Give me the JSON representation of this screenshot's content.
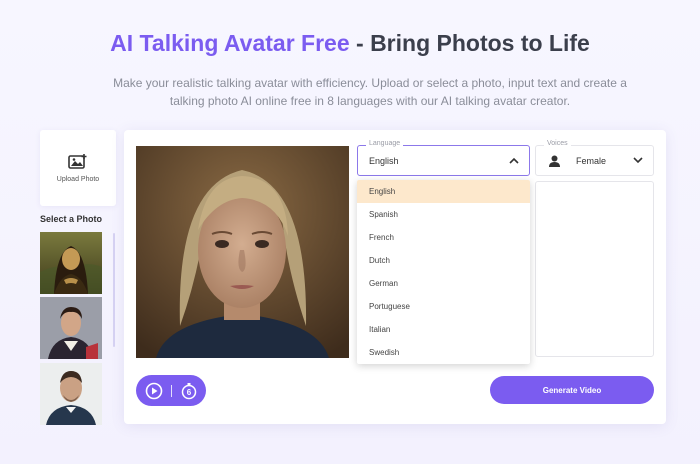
{
  "header": {
    "title_accent": "AI Talking Avatar Free",
    "title_rest": " - Bring Photos to Life",
    "subtitle": "Make your realistic talking avatar with efficiency. Upload or select a photo, input text and create a talking photo AI online free in 8 languages with our AI talking avatar creator."
  },
  "sidebar": {
    "upload_label": "Upload Photo",
    "select_label": "Select a Photo",
    "photos": [
      "mona-lisa",
      "napoleon",
      "man-portrait"
    ]
  },
  "language": {
    "label": "Language",
    "selected": "English",
    "options": [
      "English",
      "Spanish",
      "French",
      "Dutch",
      "German",
      "Portuguese",
      "Italian",
      "Swedish"
    ]
  },
  "voice": {
    "label": "Voices",
    "selected": "Female"
  },
  "controls": {
    "timer_value": "6",
    "generate_label": "Generate Video"
  },
  "colors": {
    "accent": "#7b5cf0",
    "selected_option": "#fde8cc"
  }
}
